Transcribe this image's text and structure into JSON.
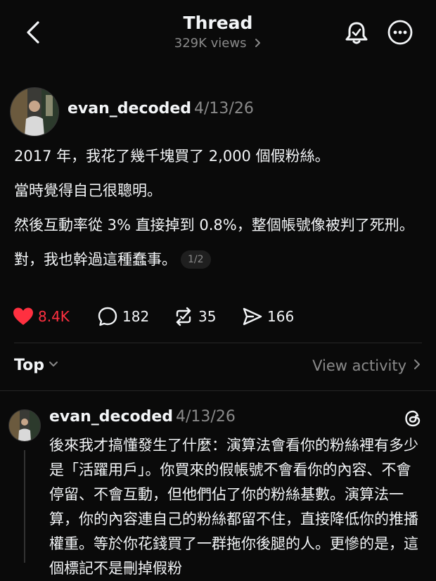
{
  "header": {
    "title": "Thread",
    "views": "329K views"
  },
  "post": {
    "username": "evan_decoded",
    "date": "4/13/26",
    "paragraphs": [
      "2017 年，我花了幾千塊買了 2,000 個假粉絲。",
      "當時覺得自己很聰明。",
      "然後互動率從 3% 直接掉到 0.8%，整個帳號像被判了死刑。",
      "對，我也幹過這種蠢事。"
    ],
    "pager": "1/2",
    "likes": "8.4K",
    "comments": "182",
    "reposts": "35",
    "shares": "166"
  },
  "sort": {
    "label": "Top",
    "view_activity": "View activity"
  },
  "reply": {
    "username": "evan_decoded",
    "date": "4/13/26",
    "text": "後來我才搞懂發生了什麼：演算法會看你的粉絲裡有多少是「活躍用戶」。你買來的假帳號不會看你的內容、不會停留、不會互動，但他們佔了你的粉絲基數。演算法一算，你的內容連自己的粉絲都留不住，直接降低你的推播權重。等於你花錢買了一群拖你後腿的人。更慘的是，這個標記不是刪掉假粉"
  },
  "colors": {
    "background": "#0a0a0a",
    "like": "#ff3040",
    "muted": "#8a8a8a"
  },
  "icons": [
    "back-icon",
    "bell-icon",
    "more-icon",
    "heart-icon",
    "comment-icon",
    "repost-icon",
    "share-icon",
    "chevron-down-icon",
    "chevron-right-icon",
    "threads-logo-icon"
  ]
}
